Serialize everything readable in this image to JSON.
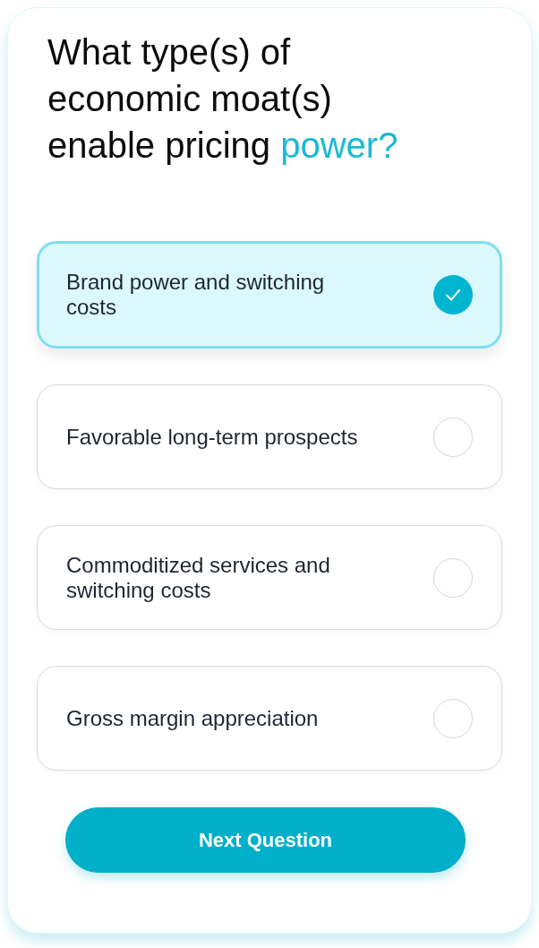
{
  "question": {
    "text": "What type(s) of economic moat(s) enable pricing",
    "highlight": "power?"
  },
  "options": [
    {
      "label": "Brand power and switching costs",
      "selected": true
    },
    {
      "label": "Favorable long-term prospects",
      "selected": false
    },
    {
      "label": "Commoditized services and switching costs",
      "selected": false
    },
    {
      "label": "Gross margin appreciation",
      "selected": false
    }
  ],
  "next_button": {
    "label": "Next Question"
  }
}
